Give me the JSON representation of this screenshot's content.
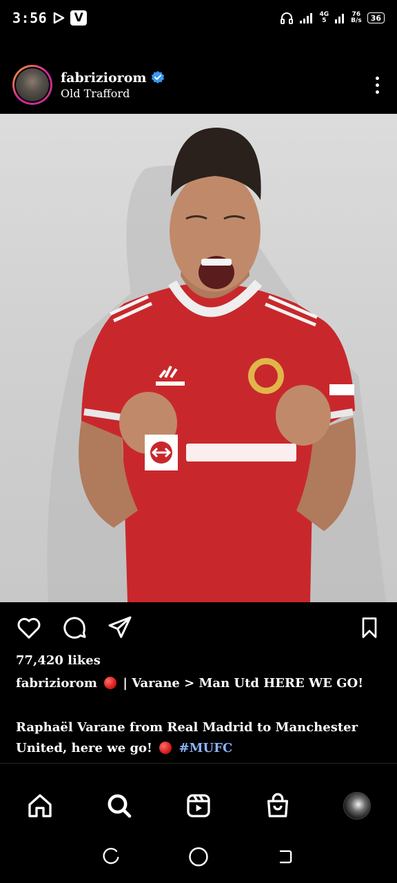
{
  "status_bar": {
    "time": "3:56",
    "app_badge": "V",
    "network_top": "4G",
    "network_bottom": "5",
    "speed_top": "76",
    "speed_bottom": "B/s",
    "battery": "36"
  },
  "post": {
    "username": "fabriziorom",
    "location": "Old Trafford",
    "verified": true,
    "image_icon": "football-player-photo",
    "likes": "77,420 likes",
    "caption_user": "fabriziorom",
    "caption_text": "| Varane > Man Utd HERE WE GO!",
    "body_text": "Raphaël Varane from Real Madrid to Manchester United, here we go!",
    "hashtag": "#MUFC"
  },
  "colors": {
    "background": "#000000",
    "verified_blue": "#3897f0",
    "hashtag": "#8ab4ff",
    "red_dot": "#d81e1e"
  },
  "icons": {
    "like": "heart-icon",
    "comment": "comment-icon",
    "share": "send-icon",
    "save": "bookmark-icon",
    "home": "home-icon",
    "search": "search-icon",
    "reels": "reels-icon",
    "shop": "shop-icon"
  }
}
